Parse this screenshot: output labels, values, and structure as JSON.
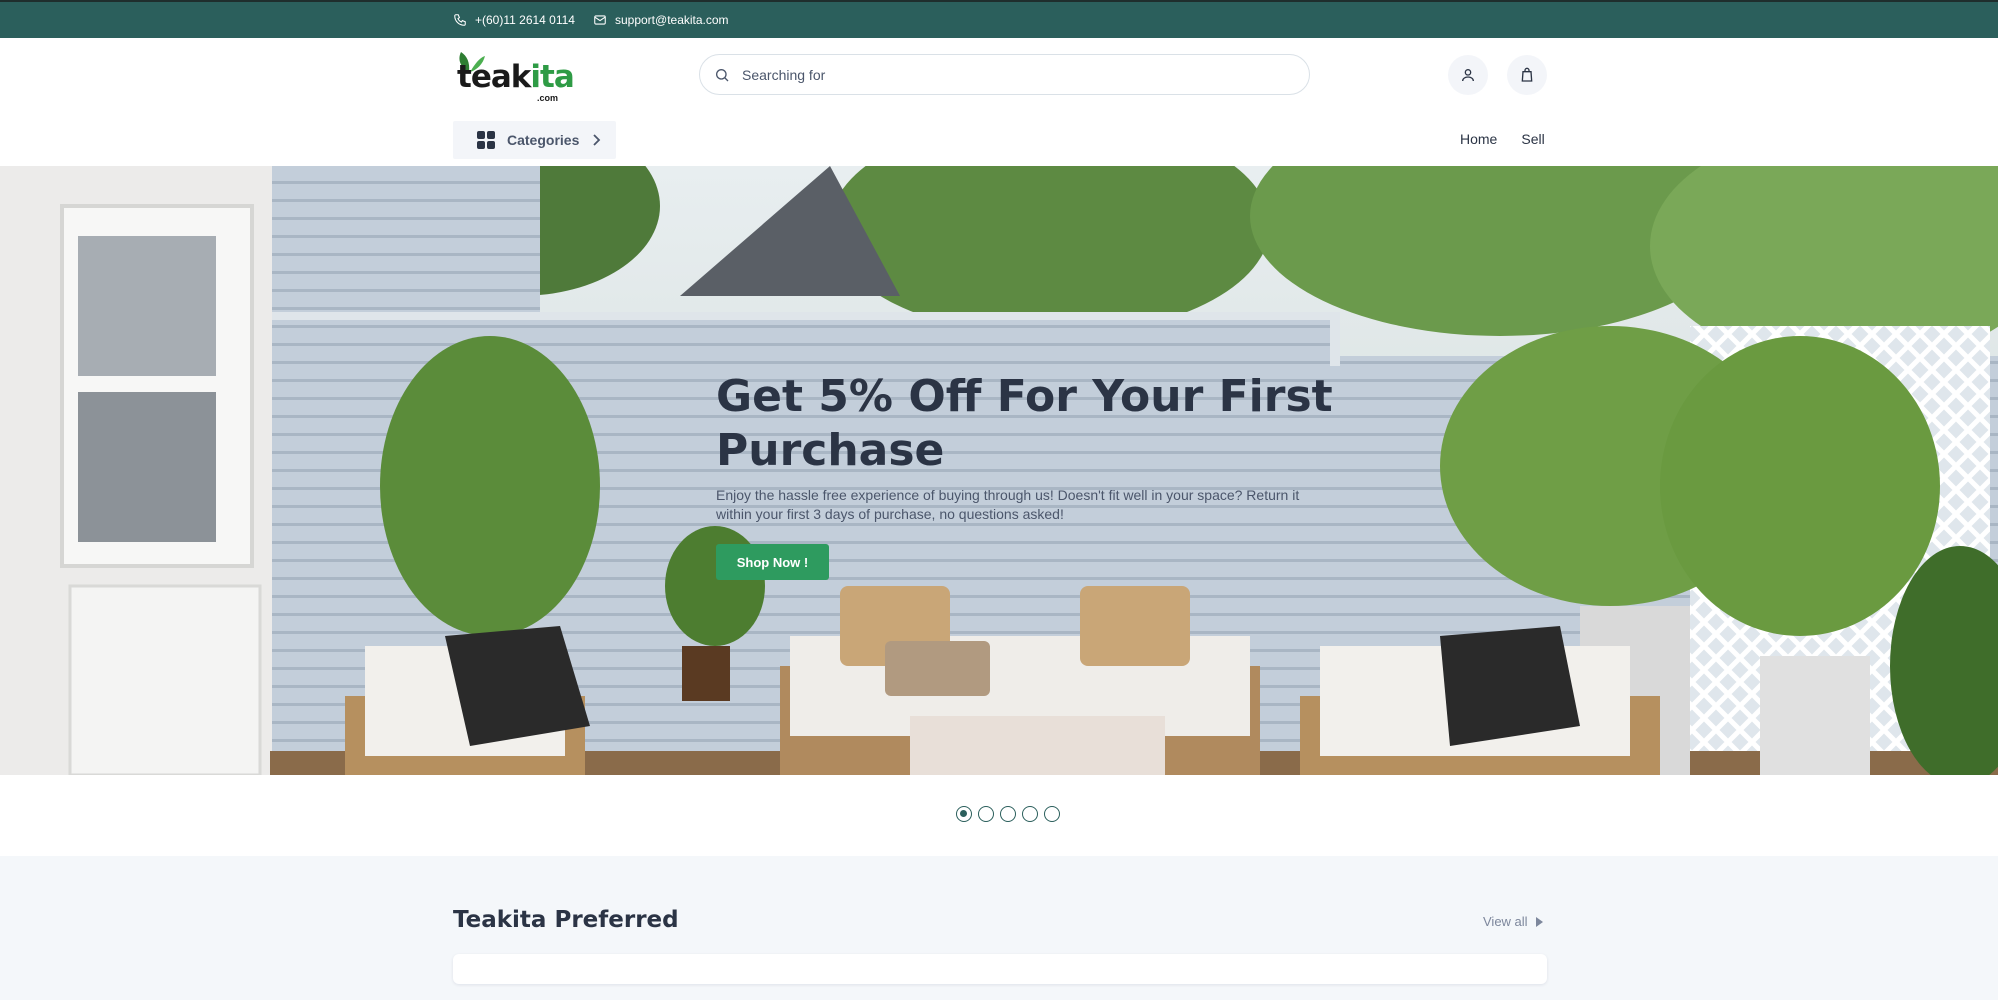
{
  "topbar": {
    "phone": "+(60)11 2614 0114",
    "email": "support@teakita.com",
    "icons": [
      "phone-icon",
      "mail-icon"
    ]
  },
  "header": {
    "logo_text_a": "teak",
    "logo_text_b": "ita",
    "logo_com": ".com",
    "search_placeholder": "Searching for",
    "categories_label": "Categories",
    "nav": {
      "home": "Home",
      "sell": "Sell"
    },
    "icons": [
      "search-icon",
      "user-icon",
      "shopping-bag-icon",
      "grid-icon",
      "chevron-right-icon"
    ]
  },
  "hero": {
    "title": "Get 5% Off For Your First Purchase",
    "description": "Enjoy the hassle free experience of buying through us! Doesn't fit well in your space? Return it within your first 3 days of purchase, no questions asked!",
    "button": "Shop Now !",
    "slides_total": 5,
    "active_slide": 1
  },
  "section": {
    "title": "Teakita Preferred",
    "view_all": "View all"
  },
  "colors": {
    "topbar": "#2b5f5c",
    "accent_green": "#2e9b5f",
    "text_dark": "#2b3445",
    "section_bg": "#f4f7fa"
  }
}
